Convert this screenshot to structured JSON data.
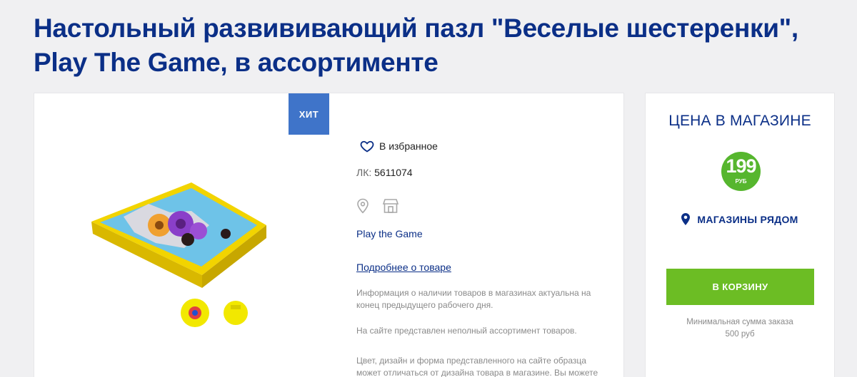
{
  "page": {
    "title_line1": "Настольный развививающий пазл \"Веселые шестеренки\",",
    "title_line2": "Play The Game, в ассортименте"
  },
  "product": {
    "badge": "ХИТ",
    "favorites_label": "В избранное",
    "sku_label": "ЛК:",
    "sku_value": "5611074",
    "brand": "Play the Game",
    "more_link": "Подробнее о товаре",
    "notes": [
      "Информация о наличии товаров в магазинах актуальна на конец предыдущего рабочего дня.",
      "На сайте представлен неполный ассортимент товаров.",
      "Цвет, дизайн и форма представленного на сайте образца может отличаться от дизайна товара в магазине. Вы можете"
    ],
    "icons": [
      "heart-icon",
      "location-pin-icon",
      "store-icon"
    ]
  },
  "price_panel": {
    "title": "ЦЕНА В МАГАЗИНЕ",
    "price": "199",
    "currency": "РУБ",
    "nearby_label": "МАГАЗИНЫ РЯДОМ",
    "cart_button": "В КОРЗИНУ",
    "min_order_line1": "Минимальная сумма заказа",
    "min_order_line2": "500 руб"
  },
  "colors": {
    "brand_blue": "#0b2f87",
    "badge_blue": "#3f74c9",
    "price_green": "#56b62e",
    "cart_green": "#6cbd24",
    "background": "#f0f0f2"
  }
}
